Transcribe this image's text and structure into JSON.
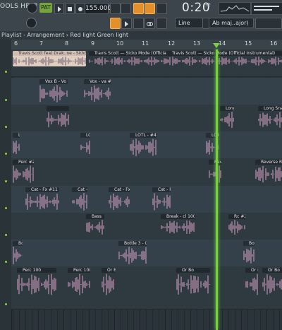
{
  "toolbar": {
    "menu_label": "OOLS HELP",
    "pattern_label": "PAT",
    "tempo": "155.000",
    "time_main": "0:20",
    "time_sub": "32",
    "snap_label": "Line",
    "key_label": "Ab maj..ajor)",
    "accent_orange": "#e3902b",
    "accent_green": "#76a43c"
  },
  "breadcrumb": {
    "text": "Playlist - Arrangement › Red light Green light"
  },
  "ruler": {
    "bars": [
      "6",
      "7",
      "8",
      "9",
      "10",
      "11",
      "12",
      "13",
      "14",
      "15",
      "16"
    ]
  },
  "tracks": [
    {
      "clips": [
        {
          "label": "Travis Scott feat Drak..ne - Sicko Mode Beta",
          "color": "#e0cfc1"
        },
        {
          "label": "Travis Scott — Sicko Mode (Official Instrumental)",
          "color": "#d9a3c7"
        },
        {
          "label": "Travis Scott — Sicko Mode (Official Instrumental)",
          "color": "#d9a3c7"
        }
      ]
    },
    {
      "clips": [
        {
          "label": "Vox B - Vo H5",
          "color": "#d9a3c7"
        },
        {
          "label": "Vox - va #2",
          "color": "#d9a3c7"
        }
      ]
    },
    {
      "clips": [
        {
          "label": "",
          "color": "#d9a3c7"
        },
        {
          "label": "Long Snare",
          "color": "#d9a3c7"
        }
      ]
    },
    {
      "clips": [
        {
          "label": "LOTL - #4",
          "color": "#d9a3c7"
        }
      ]
    },
    {
      "clips": [
        {
          "label": "Perc #2",
          "color": "#d9a3c7"
        },
        {
          "label": "Reverse Rise",
          "color": "#d9a3c7"
        }
      ]
    },
    {
      "clips": [
        {
          "label": "Cat - Fx #11",
          "color": "#d9a3c7"
        }
      ]
    },
    {
      "clips": [
        {
          "label": "Bass",
          "color": "#d9a3c7"
        },
        {
          "label": "Break - cl 100",
          "color": "#d9a3c7"
        },
        {
          "label": "Rc #2",
          "color": "#d9a3c7"
        }
      ]
    },
    {
      "clips": [
        {
          "label": "Bottle 3 - Gl #2",
          "color": "#d9a3c7"
        }
      ]
    },
    {
      "clips": [
        {
          "label": "Perc 100",
          "color": "#d9a3c7"
        },
        {
          "label": "Perc 100",
          "color": "#d9a3c7"
        },
        {
          "label": "Or Bo",
          "color": "#d9a3c7"
        }
      ]
    }
  ]
}
